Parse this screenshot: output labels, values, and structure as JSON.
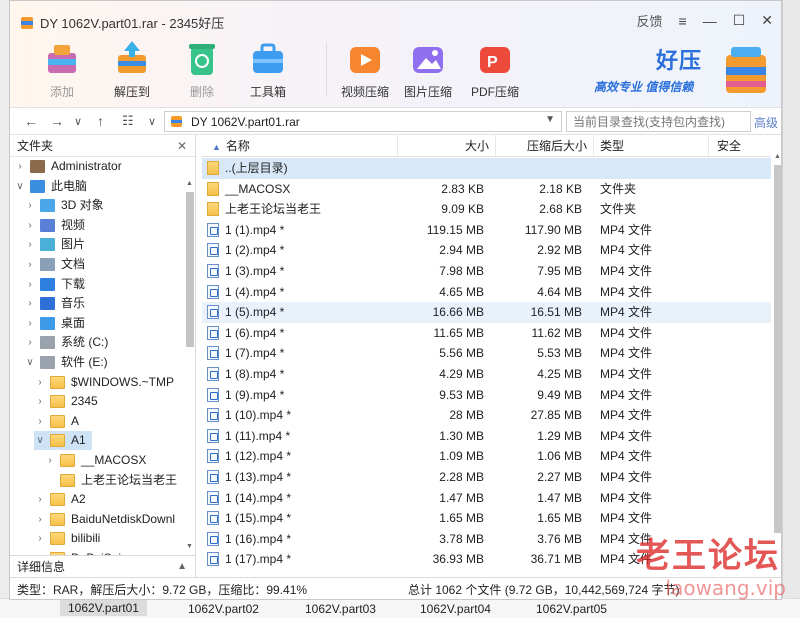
{
  "window": {
    "title": "DY 1062V.part01.rar - 2345好压",
    "feedback": "反馈"
  },
  "toolbar": [
    {
      "label": "添加",
      "disabled": true,
      "icon": "add-archive-icon"
    },
    {
      "label": "解压到",
      "disabled": false,
      "icon": "extract-to-icon"
    },
    {
      "label": "删除",
      "disabled": true,
      "icon": "recycle-delete-icon"
    },
    {
      "label": "工具箱",
      "disabled": false,
      "icon": "toolbox-icon"
    },
    {
      "label": "视频压缩",
      "disabled": false,
      "icon": "video-compress-icon"
    },
    {
      "label": "图片压缩",
      "disabled": false,
      "icon": "image-compress-icon"
    },
    {
      "label": "PDF压缩",
      "disabled": false,
      "icon": "pdf-compress-icon"
    }
  ],
  "brand": {
    "name": "好压",
    "slogan": "高效专业 值得信赖"
  },
  "nav": {
    "path": "DY 1062V.part01.rar",
    "search_placeholder": "当前目录查找(支持包内查找)",
    "advanced": "高级"
  },
  "tree": {
    "header": "文件夹",
    "footer": "详细信息",
    "items": [
      {
        "label": "Administrator",
        "level": 0,
        "arrow": ">",
        "icon": "user-icon"
      },
      {
        "label": "此电脑",
        "level": 0,
        "arrow": "v",
        "icon": "computer-icon"
      },
      {
        "label": "3D 对象",
        "level": 1,
        "arrow": ">",
        "icon": "3d-objects-icon"
      },
      {
        "label": "视频",
        "level": 1,
        "arrow": ">",
        "icon": "video-folder-icon"
      },
      {
        "label": "图片",
        "level": 1,
        "arrow": ">",
        "icon": "pictures-folder-icon"
      },
      {
        "label": "文档",
        "level": 1,
        "arrow": ">",
        "icon": "documents-folder-icon"
      },
      {
        "label": "下载",
        "level": 1,
        "arrow": ">",
        "icon": "download-folder-icon"
      },
      {
        "label": "音乐",
        "level": 1,
        "arrow": ">",
        "icon": "music-folder-icon"
      },
      {
        "label": "桌面",
        "level": 1,
        "arrow": ">",
        "icon": "desktop-folder-icon"
      },
      {
        "label": "系统 (C:)",
        "level": 1,
        "arrow": ">",
        "icon": "drive-icon"
      },
      {
        "label": "软件 (E:)",
        "level": 1,
        "arrow": "v",
        "icon": "drive-icon"
      },
      {
        "label": "$WINDOWS.~TMP",
        "level": 2,
        "arrow": ">",
        "icon": "folder-icon"
      },
      {
        "label": "2345",
        "level": 2,
        "arrow": ">",
        "icon": "folder-icon"
      },
      {
        "label": "A",
        "level": 2,
        "arrow": ">",
        "icon": "folder-icon"
      },
      {
        "label": "A1",
        "level": 2,
        "arrow": "v",
        "icon": "folder-icon",
        "selected": true
      },
      {
        "label": "__MACOSX",
        "level": 3,
        "arrow": ">",
        "icon": "folder-icon"
      },
      {
        "label": "上老王论坛当老王",
        "level": 3,
        "arrow": "",
        "icon": "folder-icon"
      },
      {
        "label": "A2",
        "level": 2,
        "arrow": ">",
        "icon": "folder-icon"
      },
      {
        "label": "BaiduNetdiskDownl",
        "level": 2,
        "arrow": ">",
        "icon": "folder-icon"
      },
      {
        "label": "bilibili",
        "level": 2,
        "arrow": ">",
        "icon": "folder-icon"
      },
      {
        "label": "DaBaiSai",
        "level": 2,
        "arrow": ">",
        "icon": "folder-icon"
      }
    ]
  },
  "list": {
    "columns": {
      "name": "名称",
      "size": "大小",
      "csize": "压缩后大小",
      "type": "类型",
      "security": "安全"
    },
    "rows": [
      {
        "name": "..(上层目录)",
        "size": "",
        "csize": "",
        "type": "",
        "icon": "folder-icon",
        "state": "sel"
      },
      {
        "name": "__MACOSX",
        "size": "2.83 KB",
        "csize": "2.18 KB",
        "type": "文件夹",
        "icon": "folder-icon"
      },
      {
        "name": "上老王论坛当老王",
        "size": "9.09 KB",
        "csize": "2.68 KB",
        "type": "文件夹",
        "icon": "folder-icon"
      },
      {
        "name": "1 (1).mp4 *",
        "size": "119.15 MB",
        "csize": "117.90 MB",
        "type": "MP4 文件",
        "icon": "mp4-file-icon"
      },
      {
        "name": "1 (2).mp4 *",
        "size": "2.94 MB",
        "csize": "2.92 MB",
        "type": "MP4 文件",
        "icon": "mp4-file-icon"
      },
      {
        "name": "1 (3).mp4 *",
        "size": "7.98 MB",
        "csize": "7.95 MB",
        "type": "MP4 文件",
        "icon": "mp4-file-icon"
      },
      {
        "name": "1 (4).mp4 *",
        "size": "4.65 MB",
        "csize": "4.64 MB",
        "type": "MP4 文件",
        "icon": "mp4-file-icon"
      },
      {
        "name": "1 (5).mp4 *",
        "size": "16.66 MB",
        "csize": "16.51 MB",
        "type": "MP4 文件",
        "icon": "mp4-file-icon",
        "state": "hl"
      },
      {
        "name": "1 (6).mp4 *",
        "size": "11.65 MB",
        "csize": "11.62 MB",
        "type": "MP4 文件",
        "icon": "mp4-file-icon"
      },
      {
        "name": "1 (7).mp4 *",
        "size": "5.56 MB",
        "csize": "5.53 MB",
        "type": "MP4 文件",
        "icon": "mp4-file-icon"
      },
      {
        "name": "1 (8).mp4 *",
        "size": "4.29 MB",
        "csize": "4.25 MB",
        "type": "MP4 文件",
        "icon": "mp4-file-icon"
      },
      {
        "name": "1 (9).mp4 *",
        "size": "9.53 MB",
        "csize": "9.49 MB",
        "type": "MP4 文件",
        "icon": "mp4-file-icon"
      },
      {
        "name": "1 (10).mp4 *",
        "size": "28 MB",
        "csize": "27.85 MB",
        "type": "MP4 文件",
        "icon": "mp4-file-icon"
      },
      {
        "name": "1 (11).mp4 *",
        "size": "1.30 MB",
        "csize": "1.29 MB",
        "type": "MP4 文件",
        "icon": "mp4-file-icon"
      },
      {
        "name": "1 (12).mp4 *",
        "size": "1.09 MB",
        "csize": "1.06 MB",
        "type": "MP4 文件",
        "icon": "mp4-file-icon"
      },
      {
        "name": "1 (13).mp4 *",
        "size": "2.28 MB",
        "csize": "2.27 MB",
        "type": "MP4 文件",
        "icon": "mp4-file-icon"
      },
      {
        "name": "1 (14).mp4 *",
        "size": "1.47 MB",
        "csize": "1.47 MB",
        "type": "MP4 文件",
        "icon": "mp4-file-icon"
      },
      {
        "name": "1 (15).mp4 *",
        "size": "1.65 MB",
        "csize": "1.65 MB",
        "type": "MP4 文件",
        "icon": "mp4-file-icon"
      },
      {
        "name": "1 (16).mp4 *",
        "size": "3.78 MB",
        "csize": "3.76 MB",
        "type": "MP4 文件",
        "icon": "mp4-file-icon"
      },
      {
        "name": "1 (17).mp4 *",
        "size": "36.93 MB",
        "csize": "36.71 MB",
        "type": "MP4 文件",
        "icon": "mp4-file-icon"
      }
    ]
  },
  "status": {
    "left": "类型：RAR，解压后大小：9.72 GB，压缩比：99.41%",
    "right": "总计 1062 个文件 (9.72 GB，10,442,569,724 字节)"
  },
  "watermark": {
    "main": "老王论坛",
    "sub": "laowang.vip"
  },
  "bottom_strip": [
    "1062V.part01",
    "1062V.part02",
    "1062V.part03",
    "1062V.part04",
    "1062V.part05"
  ]
}
